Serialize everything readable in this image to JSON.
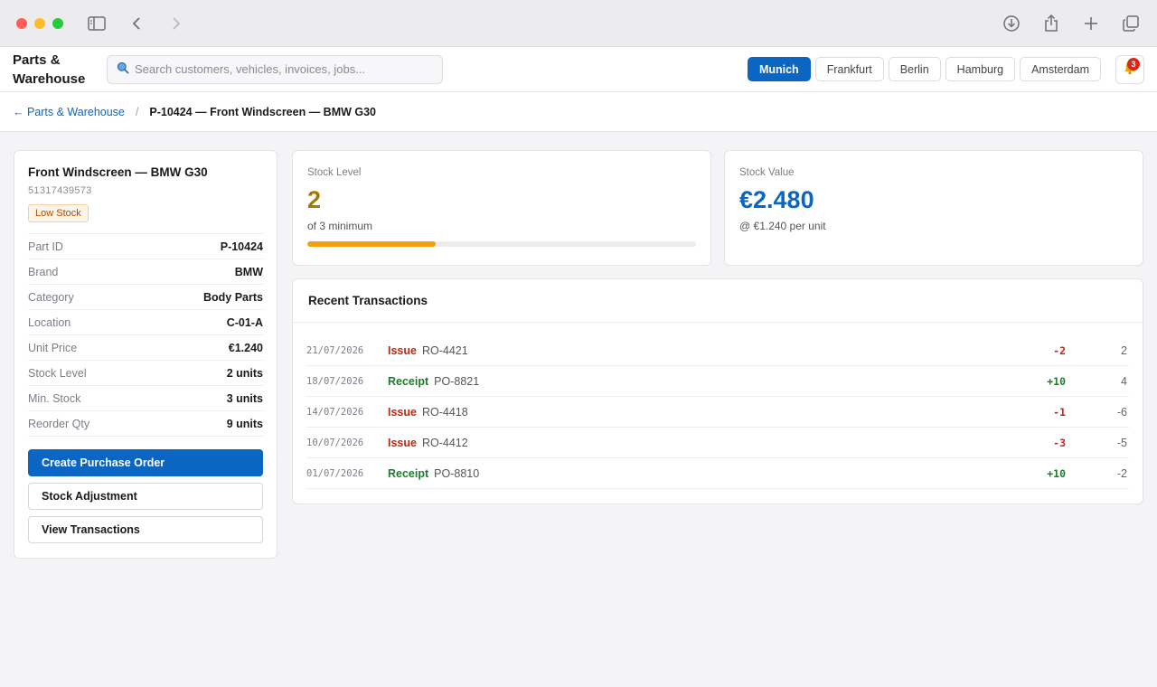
{
  "app": {
    "brand": "Parts & Warehouse",
    "search_placeholder": "Search customers, vehicles, invoices, jobs...",
    "locations": [
      {
        "label": "Munich",
        "active": true
      },
      {
        "label": "Frankfurt",
        "active": false
      },
      {
        "label": "Berlin",
        "active": false
      },
      {
        "label": "Hamburg",
        "active": false
      },
      {
        "label": "Amsterdam",
        "active": false
      }
    ],
    "notification_count": "3"
  },
  "breadcrumb": {
    "back": "← Parts & Warehouse",
    "separator": "/",
    "current": "P-10424 — Front Windscreen — BMW G30"
  },
  "part": {
    "title": "Front Windscreen — BMW G30",
    "code": "51317439573",
    "status": "Low Stock",
    "details": [
      {
        "label": "Part ID",
        "value": "P-10424"
      },
      {
        "label": "Brand",
        "value": "BMW"
      },
      {
        "label": "Category",
        "value": "Body Parts"
      },
      {
        "label": "Location",
        "value": "C-01-A"
      },
      {
        "label": "Unit Price",
        "value": "€1.240"
      },
      {
        "label": "Stock Level",
        "value": "2 units"
      },
      {
        "label": "Min. Stock",
        "value": "3 units"
      },
      {
        "label": "Reorder Qty",
        "value": "9 units"
      }
    ],
    "actions": {
      "create_po": "Create Purchase Order",
      "adjust": "Stock Adjustment",
      "view_tx": "View Transactions"
    }
  },
  "stock_level": {
    "label": "Stock Level",
    "value": "2",
    "sub": "of 3 minimum",
    "progress_percent": 33
  },
  "stock_value": {
    "label": "Stock Value",
    "value": "€2.480",
    "sub": "@ €1.240 per unit"
  },
  "transactions": {
    "title": "Recent Transactions",
    "rows": [
      {
        "date": "21/07/2026",
        "type": "Issue",
        "ref": "RO-4421",
        "qty": "-2",
        "balance": "2"
      },
      {
        "date": "18/07/2026",
        "type": "Receipt",
        "ref": "PO-8821",
        "qty": "+10",
        "balance": "4"
      },
      {
        "date": "14/07/2026",
        "type": "Issue",
        "ref": "RO-4418",
        "qty": "-1",
        "balance": "-6"
      },
      {
        "date": "10/07/2026",
        "type": "Issue",
        "ref": "RO-4412",
        "qty": "-3",
        "balance": "-5"
      },
      {
        "date": "01/07/2026",
        "type": "Receipt",
        "ref": "PO-8810",
        "qty": "+10",
        "balance": "-2"
      }
    ]
  },
  "colors": {
    "accent": "#0b66c3",
    "warning": "#f0a20e",
    "issue": "#b52a18",
    "receipt": "#1e7d2a"
  }
}
